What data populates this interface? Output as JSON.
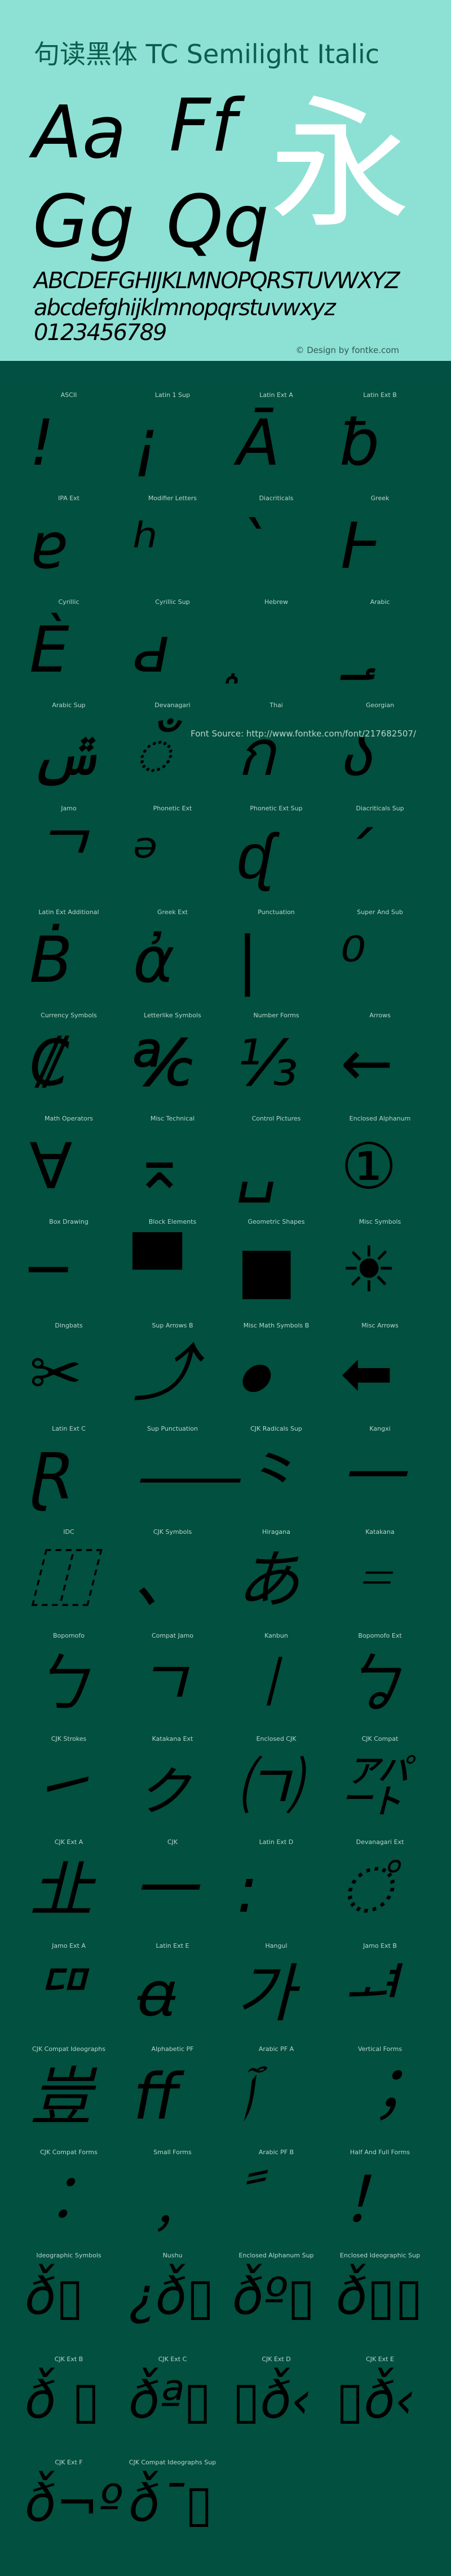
{
  "title": "句读黑体 TC Semilight Italic",
  "specimen": {
    "pairs": [
      "Aa",
      "Ff",
      "Gg",
      "Qq"
    ],
    "cjk_sample": "永",
    "uppercase": "ABCDEFGHIJKLMNOPQRSTUVWXYZ",
    "lowercase": "abcdefghijklmnopqrstuvwxyz",
    "digits": "0123456789"
  },
  "credit": "© Design by fontke.com",
  "font_source": "Font Source: http://www.fontke.com/font/217682507/",
  "colors": {
    "hero_bg": "#8de0d4",
    "title": "#0b5e4d",
    "grid_bg": "#02503f",
    "label": "#b9d6cf",
    "glyph": "#000000",
    "cjk_sample": "#ffffff"
  },
  "blocks": [
    {
      "label": "ASCII",
      "glyph": "!"
    },
    {
      "label": "Latin 1 Sup",
      "glyph": "¡"
    },
    {
      "label": "Latin Ext A",
      "glyph": "Ā"
    },
    {
      "label": "Latin Ext B",
      "glyph": "ƀ"
    },
    {
      "label": "IPA Ext",
      "glyph": "ɐ"
    },
    {
      "label": "Modifier Letters",
      "glyph": "ʰ"
    },
    {
      "label": "Diacriticals",
      "glyph": "ˋ"
    },
    {
      "label": "Greek",
      "glyph": "Ͱ"
    },
    {
      "label": "Cyrillic",
      "glyph": "Ѐ"
    },
    {
      "label": "Cyrillic Sup",
      "glyph": "ԁ"
    },
    {
      "label": "Hebrew",
      "glyph": "֑"
    },
    {
      "label": "Arabic",
      "glyph": "؀"
    },
    {
      "label": "Arabic Sup",
      "glyph": "ݜ"
    },
    {
      "label": "Devanagari",
      "glyph": "ँ"
    },
    {
      "label": "Thai",
      "glyph": "ก"
    },
    {
      "label": "Georgian",
      "glyph": "ა"
    },
    {
      "label": "Jamo",
      "glyph": "ᄀ"
    },
    {
      "label": "Phonetic Ext",
      "glyph": "ᵊ"
    },
    {
      "label": "Phonetic Ext Sup",
      "glyph": "ᶑ"
    },
    {
      "label": "Diacriticals Sup",
      "glyph": "´"
    },
    {
      "label": "Latin Ext Additional",
      "glyph": "Ḃ"
    },
    {
      "label": "Greek Ext",
      "glyph": "ἀ"
    },
    {
      "label": "Punctuation",
      "glyph": "|"
    },
    {
      "label": "Super And Sub",
      "glyph": "⁰"
    },
    {
      "label": "Currency Symbols",
      "glyph": "₡"
    },
    {
      "label": "Letterlike Symbols",
      "glyph": "℀"
    },
    {
      "label": "Number Forms",
      "glyph": "⅓"
    },
    {
      "label": "Arrows",
      "glyph": "←"
    },
    {
      "label": "Math Operators",
      "glyph": "∀"
    },
    {
      "label": "Misc Technical",
      "glyph": "⌅"
    },
    {
      "label": "Control Pictures",
      "glyph": "␣"
    },
    {
      "label": "Enclosed Alphanum",
      "glyph": "①"
    },
    {
      "label": "Box Drawing",
      "glyph": "─"
    },
    {
      "label": "Block Elements",
      "glyph": "▀"
    },
    {
      "label": "Geometric Shapes",
      "glyph": "■"
    },
    {
      "label": "Misc Symbols",
      "glyph": "☀"
    },
    {
      "label": "Dingbats",
      "glyph": "✂"
    },
    {
      "label": "Sup Arrows B",
      "glyph": "⤴"
    },
    {
      "label": "Misc Math Symbols B",
      "glyph": "⦁"
    },
    {
      "label": "Misc Arrows",
      "glyph": "⬅"
    },
    {
      "label": "Latin Ext C",
      "glyph": "Ɽ"
    },
    {
      "label": "Sup Punctuation",
      "glyph": "⸺"
    },
    {
      "label": "CJK Radicals Sup",
      "glyph": "⺀"
    },
    {
      "label": "Kangxi",
      "glyph": "⼀"
    },
    {
      "label": "IDC",
      "glyph": "⿰"
    },
    {
      "label": "CJK Symbols",
      "glyph": "、"
    },
    {
      "label": "Hiragana",
      "glyph": "あ"
    },
    {
      "label": "Katakana",
      "glyph": "゠"
    },
    {
      "label": "Bopomofo",
      "glyph": "ㄅ"
    },
    {
      "label": "Compat Jamo",
      "glyph": "ㄱ"
    },
    {
      "label": "Kanbun",
      "glyph": "㆐"
    },
    {
      "label": "Bopomofo Ext",
      "glyph": "ㆠ"
    },
    {
      "label": "CJK Strokes",
      "glyph": "㇀"
    },
    {
      "label": "Katakana Ext",
      "glyph": "ㇰ"
    },
    {
      "label": "Enclosed CJK",
      "glyph": "㈀"
    },
    {
      "label": "CJK Compat",
      "glyph": "㌀"
    },
    {
      "label": "CJK Ext A",
      "glyph": "㐀"
    },
    {
      "label": "CJK",
      "glyph": "一"
    },
    {
      "label": "Latin Ext D",
      "glyph": "꞉"
    },
    {
      "label": "Devanagari Ext",
      "glyph": "꣠"
    },
    {
      "label": "Jamo Ext A",
      "glyph": "ꥠ"
    },
    {
      "label": "Latin Ext E",
      "glyph": "ꬰ"
    },
    {
      "label": "Hangul",
      "glyph": "가"
    },
    {
      "label": "Jamo Ext B",
      "glyph": "ힰ"
    },
    {
      "label": "CJK Compat Ideographs",
      "glyph": "豈"
    },
    {
      "label": "Alphabetic PF",
      "glyph": "ﬀ"
    },
    {
      "label": "Arabic PF A",
      "glyph": "ﭐ"
    },
    {
      "label": "Vertical Forms",
      "glyph": "︔"
    },
    {
      "label": "CJK Compat Forms",
      "glyph": "︰"
    },
    {
      "label": "Small Forms",
      "glyph": "﹐"
    },
    {
      "label": "Arabic PF B",
      "glyph": "ﹰ"
    },
    {
      "label": "Half And Full Forms",
      "glyph": "！"
    },
    {
      "label": "Ideographic Symbols",
      "glyph": "ð̌▯"
    },
    {
      "label": "Nushu",
      "glyph": "¿ð̌▯"
    },
    {
      "label": "Enclosed Alphanum Sup",
      "glyph": "ð̌º▯"
    },
    {
      "label": "Enclosed Ideographic Sup",
      "glyph": "ð̌▯▯"
    },
    {
      "label": "CJK Ext B",
      "glyph": "ð̌ ▯"
    },
    {
      "label": "CJK Ext C",
      "glyph": "ð̌ª▯"
    },
    {
      "label": "CJK Ext D",
      "glyph": "▯ð̌‹"
    },
    {
      "label": "CJK Ext E",
      "glyph": "▯ð̌‹"
    },
    {
      "label": "CJK Ext F",
      "glyph": "ð̌¬º"
    },
    {
      "label": "CJK Compat Ideographs Sup",
      "glyph": "ð̌¯▯"
    }
  ]
}
